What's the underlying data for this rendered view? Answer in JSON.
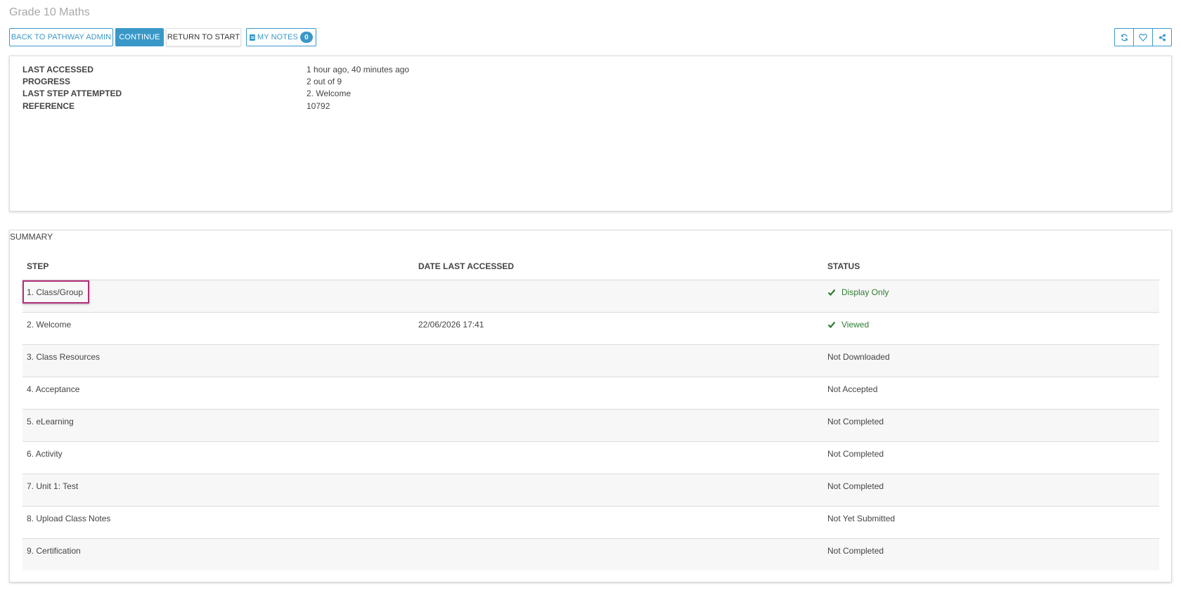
{
  "page": {
    "title": "Grade 10 Maths"
  },
  "toolbar": {
    "back_label": "BACK TO PATHWAY ADMIN",
    "continue_label": "CONTINUE",
    "return_label": "RETURN TO START",
    "notes_label": "MY NOTES",
    "notes_count": "0"
  },
  "icons": {
    "refresh": "refresh-icon",
    "favorite": "heart-icon",
    "share": "share-icon",
    "notes": "notes-icon",
    "check": "check-icon"
  },
  "info": {
    "last_accessed": {
      "label": "LAST ACCESSED",
      "value": "1 hour ago, 40 minutes ago"
    },
    "progress": {
      "label": "PROGRESS",
      "value": "2 out of 9"
    },
    "last_step": {
      "label": "LAST STEP ATTEMPTED",
      "value": "2. Welcome"
    },
    "reference": {
      "label": "REFERENCE",
      "value": "10792"
    }
  },
  "summary": {
    "title": "SUMMARY",
    "columns": [
      "STEP",
      "DATE LAST ACCESSED",
      "STATUS"
    ],
    "rows": [
      {
        "step": "1. Class/Group",
        "date": "",
        "status": "Display Only"
      },
      {
        "step": "2. Welcome",
        "date": "22/06/2026 17:41",
        "status": "Viewed"
      },
      {
        "step": "3. Class Resources",
        "date": "",
        "status": "Not Downloaded"
      },
      {
        "step": "4. Acceptance",
        "date": "",
        "status": "Not Accepted"
      },
      {
        "step": "5. eLearning",
        "date": "",
        "status": "Not Completed"
      },
      {
        "step": "6. Activity",
        "date": "",
        "status": "Not Completed"
      },
      {
        "step": "7. Unit 1: Test",
        "date": "",
        "status": "Not Completed"
      },
      {
        "step": "8. Upload Class Notes",
        "date": "",
        "status": "Not Yet Submitted"
      },
      {
        "step": "9. Certification",
        "date": "",
        "status": "Not Completed"
      }
    ]
  },
  "colors": {
    "accent": "#3a98c9",
    "success": "#2e7d32",
    "highlight": "#b0307a"
  }
}
